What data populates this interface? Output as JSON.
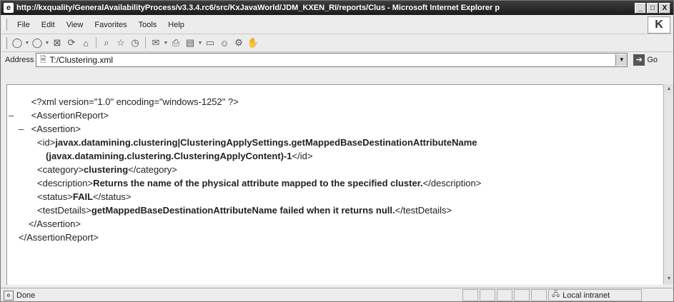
{
  "window": {
    "title": "http://kxquality/GeneralAvailabilityProcess/v3.3.4.rc6/src/KxJavaWorld/JDM_KXEN_RI/reports/Clus - Microsoft Internet Explorer p",
    "minimize": "_",
    "maximize": "□",
    "close": "X"
  },
  "menu": {
    "items": [
      "File",
      "Edit",
      "View",
      "Favorites",
      "Tools",
      "Help"
    ],
    "brand": "K"
  },
  "toolbar": {
    "icons": [
      "back-icon",
      "forward-icon",
      "stop-icon",
      "refresh-icon",
      "home-icon",
      "search-icon",
      "favorites-icon",
      "history-icon",
      "mail-icon",
      "print-icon",
      "edit-icon",
      "discuss-icon",
      "messenger-icon",
      "research-icon",
      "pan-icon"
    ]
  },
  "address": {
    "label": "Address",
    "value": "T:/Clustering.xml",
    "go_label": "Go"
  },
  "xml": {
    "declaration": "<?xml version=\"1.0\" encoding=\"windows-1252\" ?>",
    "report_open": "<AssertionReport>",
    "assertion_open": "<Assertion>",
    "id_open": "<id>",
    "id_value_line1": "javax.datamining.clustering|ClusteringApplySettings.getMappedBaseDestinationAttributeName",
    "id_value_line2": "(javax.datamining.clustering.ClusteringApplyContent)-1",
    "id_close": "</id>",
    "category_open": "<category>",
    "category_value": "clustering",
    "category_close": "</category>",
    "description_open": "<description>",
    "description_value": "Returns the name of the physical attribute mapped to the specified cluster.",
    "description_close": "</description>",
    "status_open": "<status>",
    "status_value": "FAIL",
    "status_close": "</status>",
    "testdetails_open": "<testDetails>",
    "testdetails_value": "getMappedBaseDestinationAttributeName failed when it returns null.",
    "testdetails_close": "</testDetails>",
    "assertion_close": "</Assertion>",
    "report_close": "</AssertionReport>",
    "collapse_marker": "–"
  },
  "status": {
    "text": "Done",
    "zone": "Local intranet"
  }
}
